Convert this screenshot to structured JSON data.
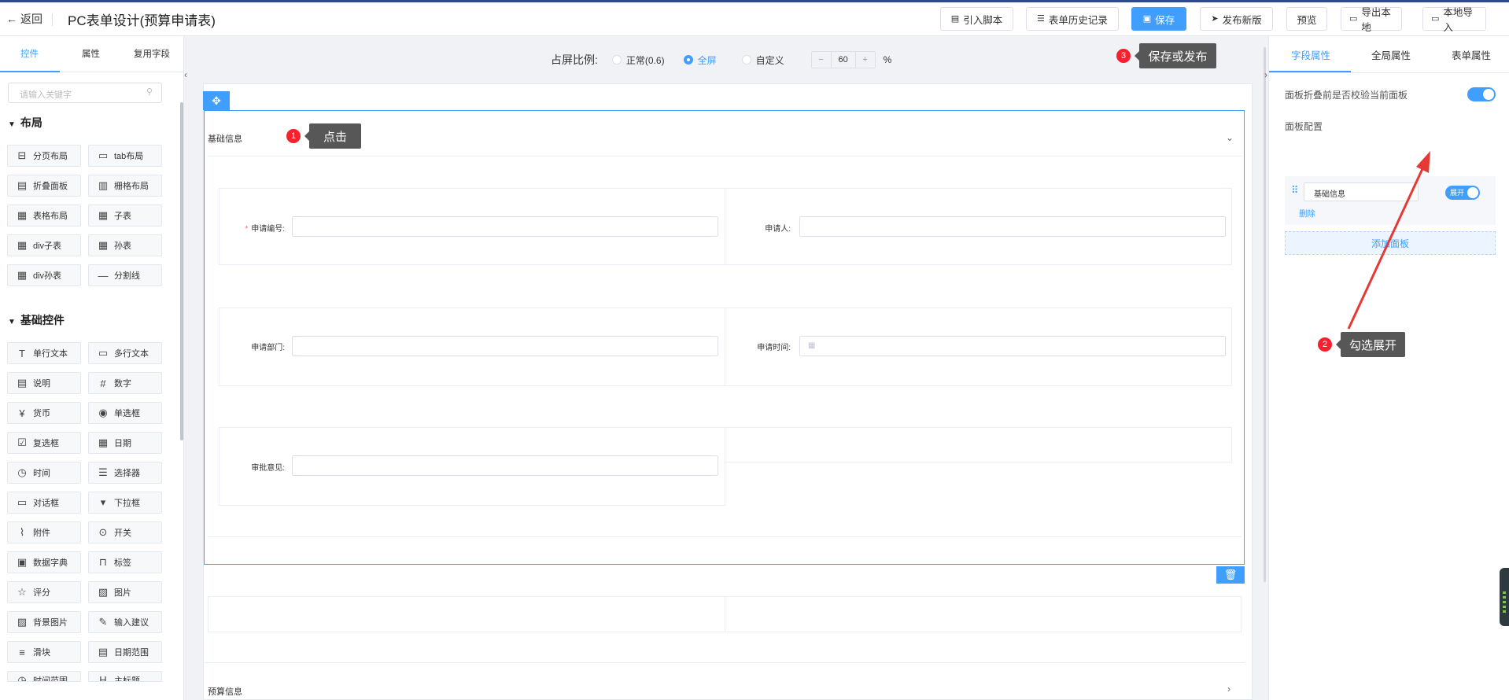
{
  "header": {
    "back_label": "返回",
    "title": "PC表单设计(预算申请表)",
    "buttons": {
      "import_script": "引入脚本",
      "history": "表单历史记录",
      "save": "保存",
      "publish": "发布新版",
      "preview": "预览",
      "export": "导出本地",
      "import_local": "本地导入"
    }
  },
  "left_panel": {
    "tabs": [
      "控件",
      "属性",
      "复用字段"
    ],
    "active_tab": "控件",
    "search_placeholder": "请输入关键字",
    "layout_section": "布局",
    "layout_items": [
      "分页布局",
      "tab布局",
      "折叠面板",
      "栅格布局",
      "表格布局",
      "子表",
      "div子表",
      "孙表",
      "div孙表",
      "分割线"
    ],
    "basic_section": "基础控件",
    "basic_items": [
      "单行文本",
      "多行文本",
      "说明",
      "数字",
      "货币",
      "单选框",
      "复选框",
      "日期",
      "时间",
      "选择器",
      "对话框",
      "下拉框",
      "附件",
      "开关",
      "数据字典",
      "标签",
      "评分",
      "图片",
      "背景图片",
      "输入建议",
      "滑块",
      "日期范围",
      "时间范围",
      "主标题"
    ]
  },
  "canvas": {
    "ratio_label": "占屏比例:",
    "ratio_options": [
      "正常(0.6)",
      "全屏",
      "自定义"
    ],
    "ratio_selected": "全屏",
    "custom_value": "60",
    "percent": "%",
    "panel1_title": "基础信息",
    "fields": {
      "apply_no": "申请编号:",
      "applicant": "申请人:",
      "department": "申请部门:",
      "apply_time": "申请时间:",
      "opinion": "审批意见:"
    },
    "panel2_title": "预算信息"
  },
  "right_panel": {
    "tabs": [
      "字段属性",
      "全局属性",
      "表单属性"
    ],
    "active_tab": "字段属性",
    "collapse_validate_label": "面板折叠前是否校验当前面板",
    "collapse_validate_on": true,
    "panel_config_label": "面板配置",
    "panel_item_name": "基础信息",
    "expand_label": "展开",
    "delete_label": "删除",
    "add_panel_label": "添加面板"
  },
  "annotations": {
    "step1": {
      "num": "1",
      "text": "点击"
    },
    "step2": {
      "num": "2",
      "text": "勾选展开"
    },
    "step3": {
      "num": "3",
      "text": "保存或发布"
    }
  },
  "colors": {
    "primary": "#409eff",
    "annotation_bg": "#575757",
    "badge_red": "#f5222d",
    "arrow_red": "#e53935"
  }
}
